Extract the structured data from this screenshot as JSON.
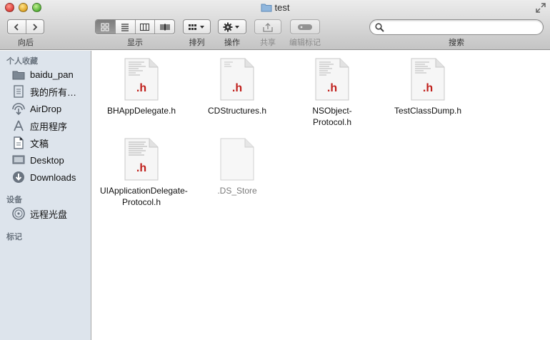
{
  "window": {
    "title": "test"
  },
  "toolbar": {
    "back_forward_label": "向后",
    "view_label": "显示",
    "arrange_label": "排列",
    "action_label": "操作",
    "share_label": "共享",
    "edit_tags_label": "编辑标记",
    "search_label": "搜索",
    "search_value": ""
  },
  "sidebar": {
    "favorites_title": "个人收藏",
    "favorites": [
      {
        "label": "baidu_pan",
        "icon": "folder-icon"
      },
      {
        "label": "我的所有…",
        "icon": "all-files-icon"
      },
      {
        "label": "AirDrop",
        "icon": "airdrop-icon"
      },
      {
        "label": "应用程序",
        "icon": "applications-icon"
      },
      {
        "label": "文稿",
        "icon": "documents-icon"
      },
      {
        "label": "Desktop",
        "icon": "desktop-icon"
      },
      {
        "label": "Downloads",
        "icon": "downloads-icon"
      }
    ],
    "devices_title": "设备",
    "devices": [
      {
        "label": "远程光盘",
        "icon": "remote-disc-icon"
      }
    ],
    "tags_title": "标记"
  },
  "files": [
    {
      "name": "BHAppDelegate.h",
      "badge": ".h"
    },
    {
      "name": "CDStructures.h",
      "badge": ".h"
    },
    {
      "name": "NSObject-Protocol.h",
      "badge": ".h"
    },
    {
      "name": "TestClassDump.h",
      "badge": ".h"
    },
    {
      "name": "UIApplicationDelegate-Protocol.h",
      "badge": ".h"
    },
    {
      "name": ".DS_Store",
      "badge": ""
    }
  ],
  "colors": {
    "header_badge": "#c0201c",
    "sidebar_bg": "#dde4ec"
  }
}
